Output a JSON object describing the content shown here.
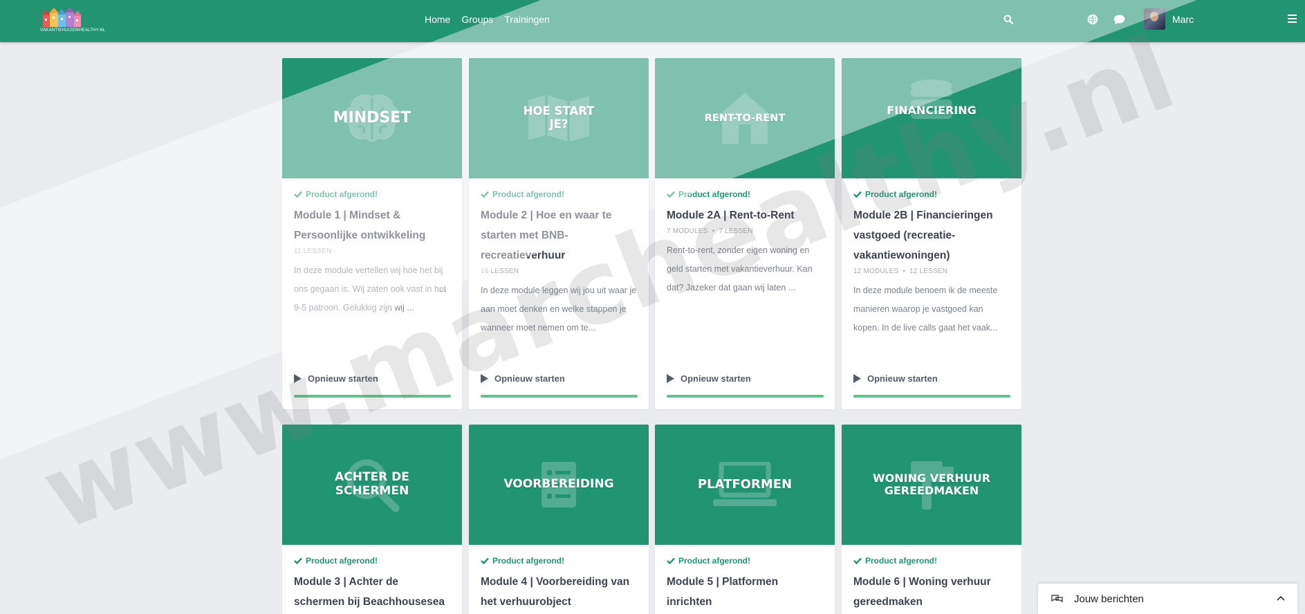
{
  "logo": {
    "text": "VAKANTIEHUIZENHEALTHY.NL"
  },
  "nav": {
    "items": [
      "Home",
      "Groups",
      "Trainingen"
    ]
  },
  "user": {
    "name": "Marc"
  },
  "cards": [
    {
      "hero": "MINDSET",
      "status": "Product afgerond!",
      "title": "Module 1 | Mindset & Persoonlijke ontwikkeling",
      "meta1": "11 LESSEN",
      "meta2": "",
      "description": "In deze module vertellen wij hoe het bij ons gegaan is. Wij zaten ook vast in het 9-5 patroon. Gelukkig zijn wij ...",
      "action": "Opnieuw starten",
      "progress": 1.0,
      "icon": "brain-icon"
    },
    {
      "hero": "HOE START JE?",
      "status": "Product afgerond!",
      "title": "Module 2 | Hoe en waar te starten met BNB-recreatieverhuur",
      "meta1": "19 LESSEN",
      "meta2": "",
      "description": "In deze module leggen wij jou uit waar je aan moet denken en welke stappen je wanneer moet nemen om te...",
      "action": "Opnieuw starten",
      "progress": 1.0,
      "icon": "map-icon"
    },
    {
      "hero": "RENT-TO-RENT",
      "status": "Product afgerond!",
      "title": "Module 2A | Rent-to-Rent",
      "meta1": "7 MODULES",
      "meta2": "7 LESSEN",
      "description": "Rent-to-rent, zonder eigen woning en geld starten met vakantieverhuur. Kan dat? Jazeker dat gaan wij laten ...",
      "action": "Opnieuw starten",
      "progress": 1.0,
      "icon": "house-icon"
    },
    {
      "hero": "FINANCIERING",
      "status": "Product afgerond!",
      "title": "Module 2B | Financieringen vastgoed (recreatie-vakantiewoningen)",
      "meta1": "12 MODULES",
      "meta2": "12 LESSEN",
      "description": "In deze module benoem ik de meeste manieren waarop je vastgoed kan kopen. In de live calls gaat het vaak...",
      "action": "Opnieuw starten",
      "progress": 1.0,
      "icon": "coins-icon"
    },
    {
      "hero": "ACHTER DE SCHERMEN",
      "status": "Product afgerond!",
      "title": "Module 3 | Achter de schermen bij Beachhousesea",
      "meta1": "",
      "meta2": "",
      "description": "",
      "action": "",
      "progress": 1.0,
      "icon": "magnifier-icon"
    },
    {
      "hero": "VOORBEREIDING",
      "status": "Product afgerond!",
      "title": "Module 4 | Voorbereiding van het verhuurobject",
      "meta1": "",
      "meta2": "",
      "description": "",
      "action": "",
      "progress": 1.0,
      "icon": "checklist-icon"
    },
    {
      "hero": "PLATFORMEN",
      "status": "Product afgerond!",
      "title": "Module 5 | Platformen inrichten",
      "meta1": "",
      "meta2": "",
      "description": "",
      "action": "",
      "progress": 1.0,
      "icon": "laptop-icon"
    },
    {
      "hero": "WONING VERHUUR GEREEDMAKEN",
      "status": "Product afgerond!",
      "title": "Module 6 | Woning verhuur gereedmaken",
      "meta1": "",
      "meta2": "",
      "description": "",
      "action": "",
      "progress": 1.0,
      "icon": "tools-icon"
    }
  ],
  "watermark": {
    "text": "www.marchealthy.nl"
  },
  "messages": {
    "label": "Jouw berichten"
  },
  "colors": {
    "primary": "#239472",
    "progress": "#5ec28d",
    "background": "#ebecef"
  }
}
